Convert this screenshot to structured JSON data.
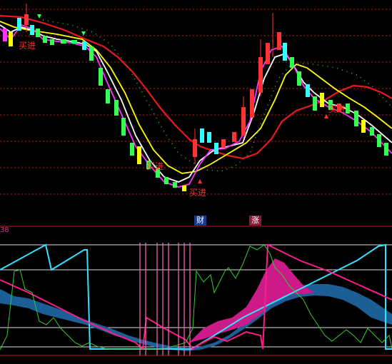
{
  "signals": {
    "buy1": "买进",
    "buy2": "买进",
    "buy3": "买进",
    "buy4": "买进"
  },
  "tags": {
    "finance": "财",
    "rise": "涨"
  },
  "indicator": {
    "label_fragment": "38"
  },
  "colors": {
    "background": "#000000",
    "grid": "#c0191b",
    "ma_white": "#ffffff",
    "ma_yellow": "#ffff00",
    "ma_magenta": "#ff33ff",
    "ma_red": "#e8191d",
    "ma_dotted": "#33cc33",
    "candle_up": "#ff3333",
    "candle_down": "#33ff55",
    "candle_flat_cyan": "#33ffff",
    "indicator_cyan": "#33e0ff",
    "indicator_pink": "#ff1a8c",
    "indicator_green": "#33cc33",
    "indicator_band_blue": "#1c5f96",
    "indicator_band_magenta": "#cc1a88",
    "vertical_markers": "#ff66bb"
  }
}
